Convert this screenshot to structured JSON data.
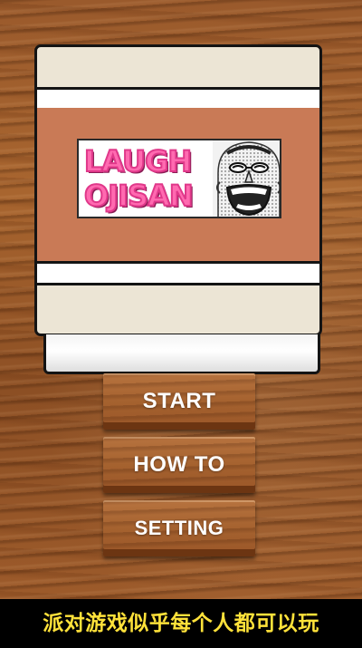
{
  "logo": {
    "line1": "LAUGH",
    "line2": "OJISAN",
    "icon": "laughing-ojisan-face",
    "text_color": "#ff6ab0"
  },
  "menu": {
    "start_label": "START",
    "howto_label": "HOW TO",
    "setting_label": "SETTING"
  },
  "caption": {
    "text": "派对游戏似乎每个人都可以玩",
    "color": "#ffe23a"
  },
  "colors": {
    "box_band": "#c97a56",
    "box_body": "#ece5d5",
    "wood": "#a5622f"
  }
}
